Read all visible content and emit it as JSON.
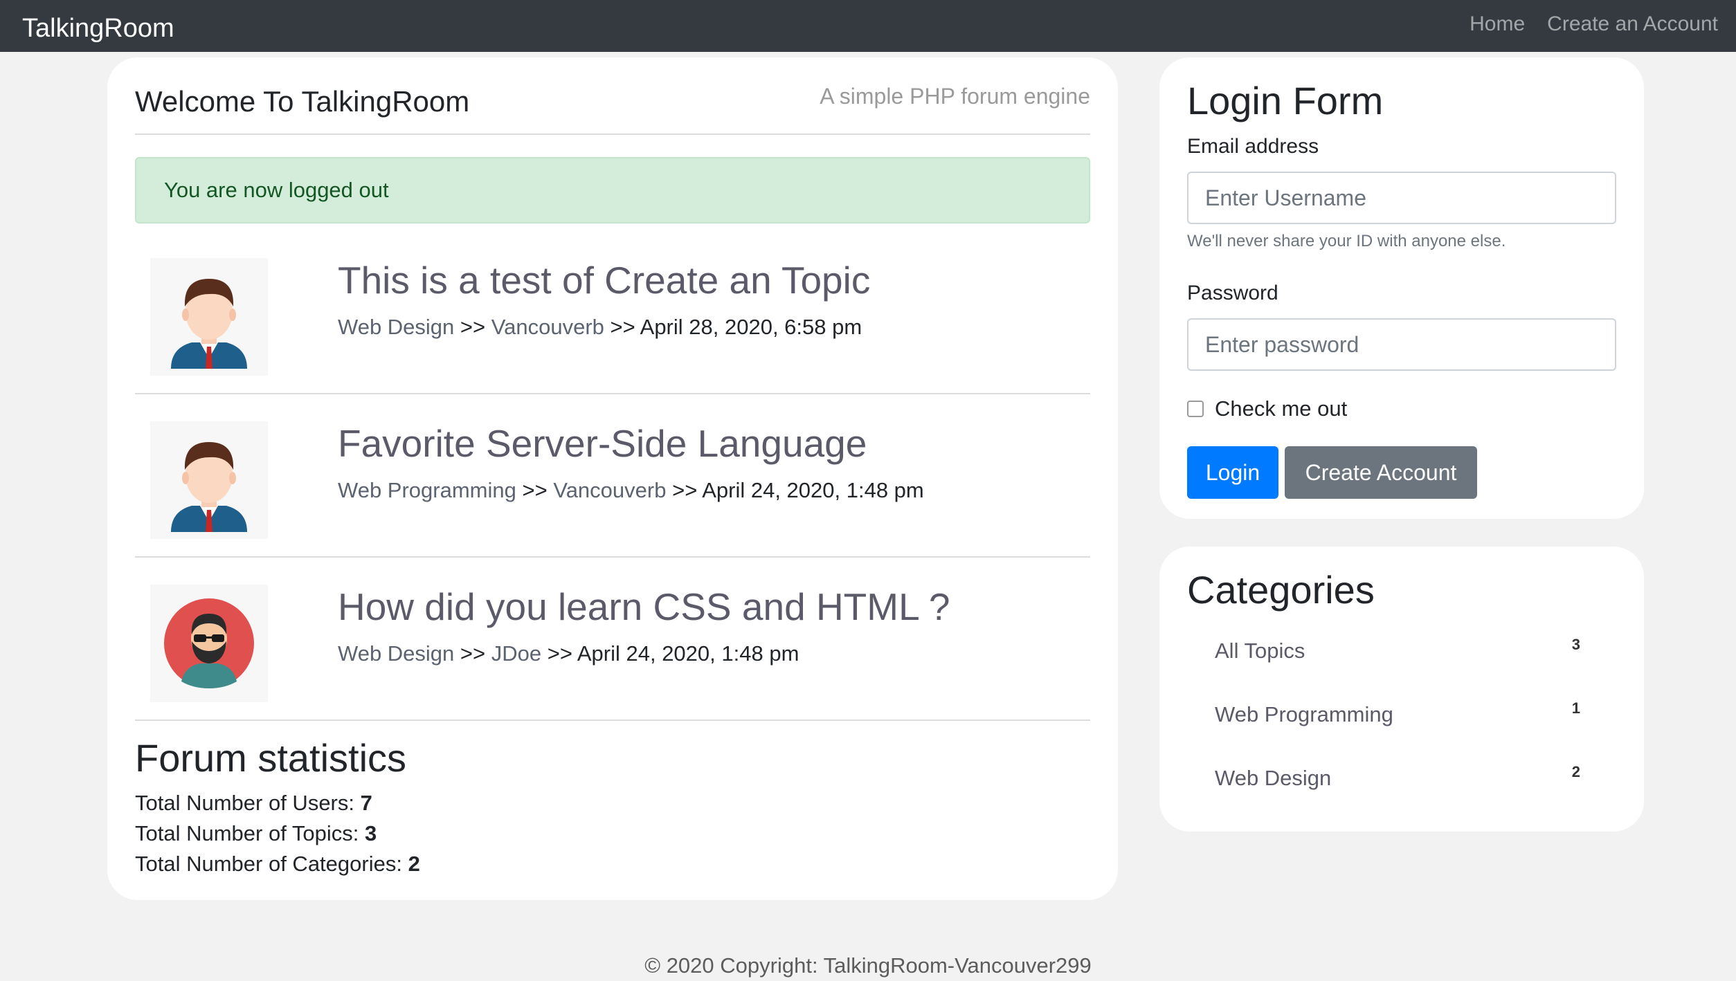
{
  "navbar": {
    "brand": "TalkingRoom",
    "links": [
      "Home",
      "Create an Account"
    ]
  },
  "main": {
    "welcome_title": "Welcome To TalkingRoom",
    "tagline": "A simple PHP forum engine",
    "alert": "You are now logged out",
    "topics": [
      {
        "title": "This is a test of Create an Topic",
        "category": "Web Design",
        "author": "Vancouverb",
        "date": "April 28, 2020, 6:58 pm",
        "avatar": "male-avatar-suit-icon"
      },
      {
        "title": "Favorite Server-Side Language",
        "category": "Web Programming",
        "author": "Vancouverb",
        "date": "April 24, 2020, 1:48 pm",
        "avatar": "male-avatar-suit-icon"
      },
      {
        "title": "How did you learn CSS and HTML ?",
        "category": "Web Design",
        "author": "JDoe",
        "date": "April 24, 2020, 1:48 pm",
        "avatar": "bearded-avatar-icon"
      }
    ],
    "separator": ">>",
    "stats": {
      "title": "Forum statistics",
      "users_label": "Total Number of Users: ",
      "users_value": "7",
      "topics_label": "Total Number of Topics: ",
      "topics_value": "3",
      "categories_label": "Total Number of Categories: ",
      "categories_value": "2"
    }
  },
  "login": {
    "title": "Login Form",
    "email_label": "Email address",
    "email_placeholder": "Enter Username",
    "help_text": "We'll never share your ID with anyone else.",
    "password_label": "Password",
    "password_placeholder": "Enter password",
    "check_label": "Check me out",
    "login_button": "Login",
    "create_button": "Create Account"
  },
  "categories": {
    "title": "Categories",
    "items": [
      {
        "name": "All Topics",
        "count": "3"
      },
      {
        "name": "Web Programming",
        "count": "1"
      },
      {
        "name": "Web Design",
        "count": "2"
      }
    ]
  },
  "footer": "© 2020 Copyright: TalkingRoom-Vancouver299",
  "colors": {
    "navbar": "#343a40",
    "primary": "#007bff",
    "secondary": "#6c757d",
    "alert_bg": "#d4edda",
    "alert_text": "#155724"
  }
}
